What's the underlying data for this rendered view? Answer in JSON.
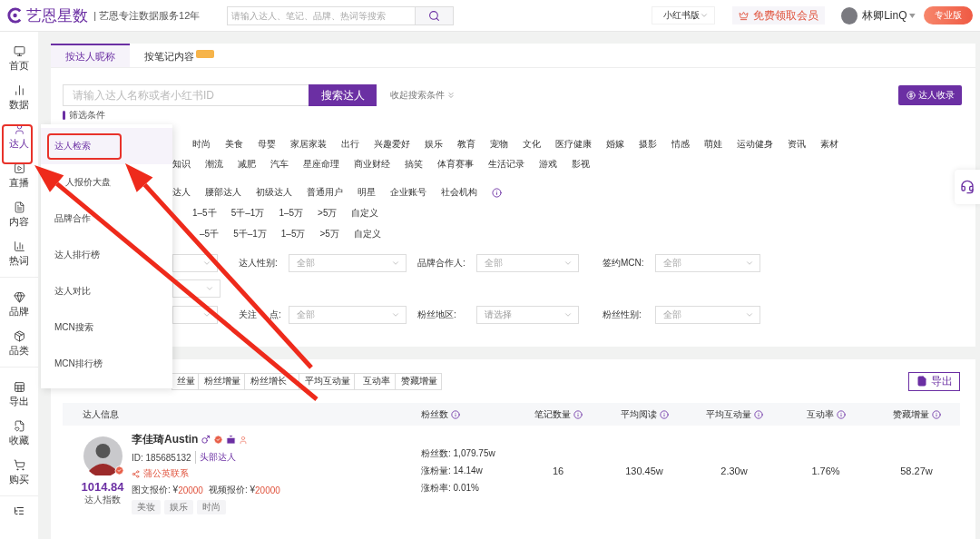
{
  "header": {
    "logo_text": "艺恩星数",
    "slogan": "| 艺恩专注数据服务12年",
    "search": {
      "placeholder": "请输入达人、笔记、品牌、热词等搜索"
    },
    "version_select": "小红书版",
    "member_button": "免费领取会员",
    "user_name": "林卿LinQ",
    "plan_button": "专业版"
  },
  "sidebar": {
    "groups": [
      [
        {
          "label": "首页",
          "selected": false
        },
        {
          "label": "数据",
          "selected": false
        },
        {
          "label": "达人",
          "selected": true
        },
        {
          "label": "直播",
          "selected": false
        },
        {
          "label": "内容",
          "selected": false
        },
        {
          "label": "热词",
          "selected": false
        }
      ],
      [
        {
          "label": "品牌",
          "selected": false
        },
        {
          "label": "品类",
          "selected": false
        }
      ],
      [
        {
          "label": "导出",
          "selected": false
        },
        {
          "label": "收藏",
          "selected": false
        },
        {
          "label": "购买",
          "selected": false
        }
      ]
    ]
  },
  "dropdown_menu": {
    "items": [
      {
        "label": "达人检索",
        "selected": true
      },
      {
        "label": "人报价大盘",
        "selected": false
      },
      {
        "label": "品牌合作",
        "selected": false
      },
      {
        "label": "达人排行榜",
        "selected": false
      },
      {
        "label": "达人对比",
        "selected": false
      },
      {
        "label": "MCN搜索",
        "selected": false
      },
      {
        "label": "MCN排行榜",
        "selected": false
      }
    ]
  },
  "search_tabs": [
    {
      "label": "按达人昵称",
      "selected": true,
      "badge": false
    },
    {
      "label": "按笔记内容",
      "selected": false,
      "badge": true
    }
  ],
  "search": {
    "placeholder": "请输入达人名称或者小红书ID",
    "button": "搜索达人",
    "toggle": "收起搜索条件",
    "collect_button": "达人收录"
  },
  "filters": {
    "heading": "筛选条件",
    "option_rows": [
      {
        "options": [
          "时尚",
          "美食",
          "母婴",
          "家居家装",
          "出行",
          "兴趣爱好",
          "娱乐",
          "教育",
          "宠物",
          "文化",
          "医疗健康",
          "婚嫁",
          "摄影",
          "情感",
          "萌娃",
          "运动健身",
          "资讯",
          "素材"
        ],
        "info": false
      },
      {
        "options": [
          "知识",
          "潮流",
          "减肥",
          "汽车",
          "星座命理",
          "商业财经",
          "搞笑",
          "体育赛事",
          "生活记录",
          "游戏",
          "影视"
        ],
        "info": false
      },
      {
        "options": [
          "达人",
          "腰部达人",
          "初级达人",
          "普通用户",
          "明星",
          "企业账号",
          "社会机构"
        ],
        "info": true
      },
      {
        "options": [
          "1–5千",
          "5千–1万",
          "1–5万",
          ">5万",
          "自定义"
        ],
        "info": false
      },
      {
        "options": [
          "–5千",
          "5千–1万",
          "1–5万",
          ">5万",
          "自定义"
        ],
        "info": false
      }
    ],
    "select_rows": [
      [
        {
          "partial": true
        },
        {
          "label": "达人性别:",
          "value": "全部"
        },
        {
          "label": "品牌合作人:",
          "value": "全部"
        },
        {
          "label": "签约MCN:",
          "value": "全部"
        }
      ],
      [
        {
          "partial": true
        }
      ],
      [
        {
          "partial": true
        },
        {
          "label": "关注",
          "label_rest": "点:",
          "value": "全部"
        },
        {
          "label": "粉丝地区:",
          "placeholder": "请选择"
        },
        {
          "label": "粉丝性别:",
          "value": "全部"
        }
      ]
    ]
  },
  "sort_tabs": [
    "丝量",
    "粉丝增量",
    "粉丝增长",
    "平均互动量",
    "互动率",
    "赞藏增量"
  ],
  "export_button": "导出",
  "table": {
    "columns": [
      {
        "label": "达人信息",
        "info": false
      },
      {
        "label": "粉丝数",
        "info": true
      },
      {
        "label": "笔记数量",
        "info": true
      },
      {
        "label": "平均阅读",
        "info": true
      },
      {
        "label": "平均互动量",
        "info": true
      },
      {
        "label": "互动率",
        "info": true
      },
      {
        "label": "赞藏增量",
        "info": true
      }
    ],
    "rows": [
      {
        "creator": {
          "name": "李佳琦Austin",
          "score": "1014.84",
          "score_label": "达人指数",
          "id": "ID: 185685132",
          "level": "头部达人",
          "contact": "蒲公英联系",
          "prices": [
            {
              "label": "图文报价: ¥",
              "amount": "20000"
            },
            {
              "label": "视频报价: ¥",
              "amount": "20000"
            }
          ],
          "tags": [
            "美妆",
            "娱乐",
            "时尚"
          ]
        },
        "fans": [
          "粉丝数: 1,079.75w",
          "涨粉量: 14.14w",
          "涨粉率: 0.01%"
        ],
        "notes": "16",
        "avg_reads": "130.45w",
        "avg_interactions": "2.30w",
        "interaction_rate": "1.76%",
        "likes_saves": "58.27w"
      }
    ]
  }
}
